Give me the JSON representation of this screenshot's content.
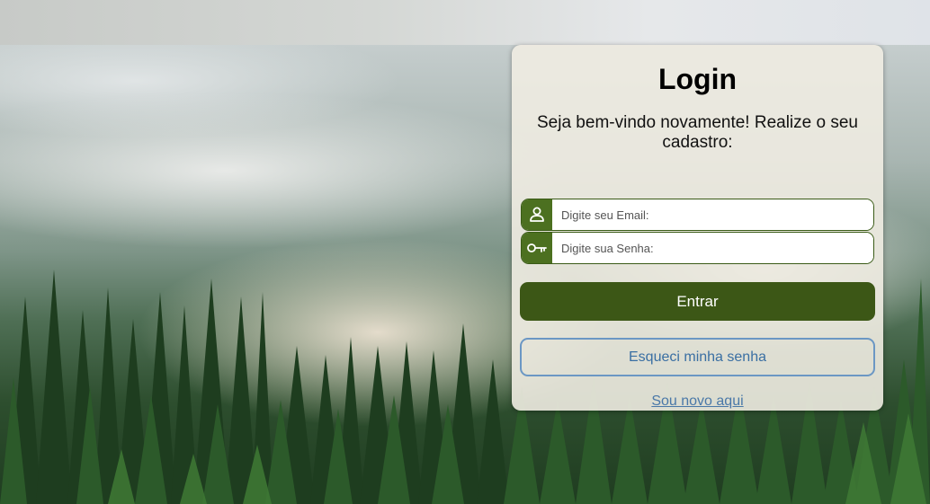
{
  "login": {
    "title": "Login",
    "subtitle": "Seja bem-vindo novamente! Realize o seu cadastro:",
    "email": {
      "placeholder": "Digite seu Email:",
      "value": "",
      "icon": "user-icon"
    },
    "password": {
      "placeholder": "Digite sua Senha:",
      "value": "",
      "icon": "key-icon"
    },
    "submit_label": "Entrar",
    "forgot_label": "Esqueci minha senha",
    "signup_label": "Sou novo aqui"
  },
  "colors": {
    "primary": "#3c5716",
    "icon_bg": "#4c7020",
    "secondary_border": "#6b97c4",
    "link": "#4a78a8"
  }
}
